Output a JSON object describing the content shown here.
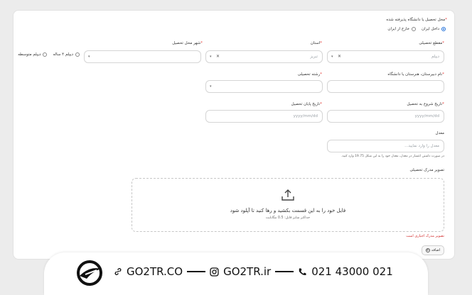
{
  "form": {
    "study_place": {
      "label": "محل تحصیل یا دانشگاه پذیرفته شده",
      "options": [
        "داخل ایران",
        "خارج از ایران"
      ],
      "selected": "داخل ایران"
    },
    "education_level": {
      "label": "مقطع تحصیلی",
      "value": "دیپلم"
    },
    "province": {
      "label": "استان",
      "value": "تبریز"
    },
    "city": {
      "label": "شهر محل تحصیل",
      "value": ""
    },
    "diploma_type": {
      "options": [
        "دیپلم ۴ ساله",
        "دیپلم متوسطه"
      ]
    },
    "school_name": {
      "label": "نام دبیرستان، هنرستان یا دانشگاه",
      "value": ""
    },
    "field_of_study": {
      "label": "رشته تحصیلی",
      "value": ""
    },
    "start_date": {
      "label": "تاریخ شروع به تحصیل",
      "placeholder": "yyyy/mm/dd"
    },
    "end_date": {
      "label": "تاریخ پایان تحصیل",
      "placeholder": "yyyy/mm/dd"
    },
    "gpa": {
      "label": "معدل",
      "placeholder": "معدل را وارد نمایید...",
      "hint": "در صورت داشتن اعشار در معدل، معدل خود را به این شکل 19.75 وارد کنید."
    },
    "certificate": {
      "label": "تصویر مدرک تحصیلی",
      "drop_text": "فایل خود را به این قسمت بکشید و رها کنید تا آپلود شود",
      "max_size": "حداکثر سایز فایل: 0.5 مگابایت",
      "error": "تصویر مدرک اجباری است"
    },
    "add_button": "اضافه"
  },
  "banner": {
    "website": "GO2TR.CO",
    "instagram": "GO2TR.ir",
    "phone": "021 43000 021"
  }
}
